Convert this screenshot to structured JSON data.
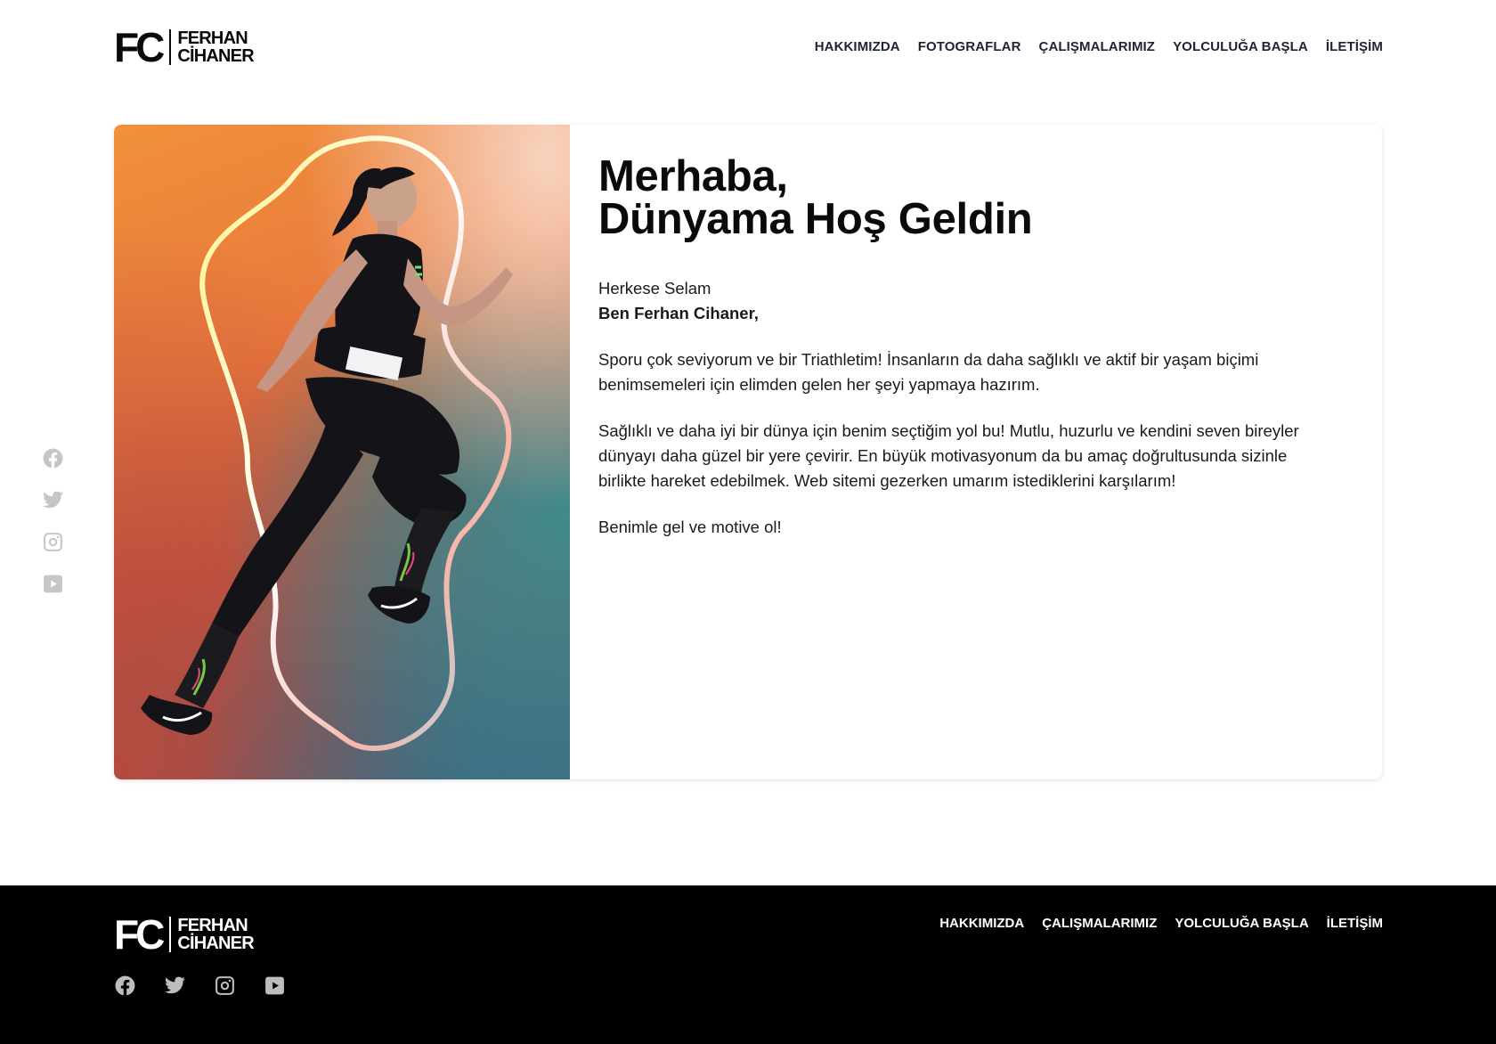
{
  "brand": {
    "mark": "FC",
    "name_line1": "FERHAN",
    "name_line2": "CİHANER"
  },
  "nav": {
    "items": [
      {
        "label": "HAKKIMIZDA"
      },
      {
        "label": "FOTOGRAFLAR"
      },
      {
        "label": "ÇALIŞMALARIMIZ"
      },
      {
        "label": "YOLCULUĞA BAŞLA"
      },
      {
        "label": "İLETİŞİM"
      }
    ]
  },
  "social": {
    "icons": [
      "facebook-icon",
      "twitter-icon",
      "instagram-icon",
      "youtube-icon"
    ],
    "color": "#c6c6c6"
  },
  "hero": {
    "heading_line1": "Merhaba,",
    "heading_line2": "Dünyama Hoş Geldin",
    "greeting": "Herkese Selam",
    "intro": "Ben Ferhan Cihaner,",
    "paragraph1": "Sporu çok seviyorum ve bir Triathletim! İnsanların da daha sağlıklı ve aktif bir yaşam biçimi benimsemeleri için elimden gelen her şeyi yapmaya hazırım.",
    "paragraph2": "Sağlıklı ve daha iyi bir dünya için benim seçtiğim yol bu! Mutlu, huzurlu ve kendini seven bireyler dünyayı daha güzel bir yere çevirir. En büyük motivasyonum da bu amaç doğrultusunda sizinle birlikte hareket edebilmek. Web sitemi gezerken umarım istediklerini karşılarım!",
    "paragraph3": "Benimle gel ve motive ol!"
  },
  "footer": {
    "nav": [
      {
        "label": "HAKKIMIZDA"
      },
      {
        "label": "ÇALIŞMALARIMIZ"
      },
      {
        "label": "YOLCULUĞA BAŞLA"
      },
      {
        "label": "İLETİŞİM"
      }
    ],
    "background": "#000000"
  }
}
